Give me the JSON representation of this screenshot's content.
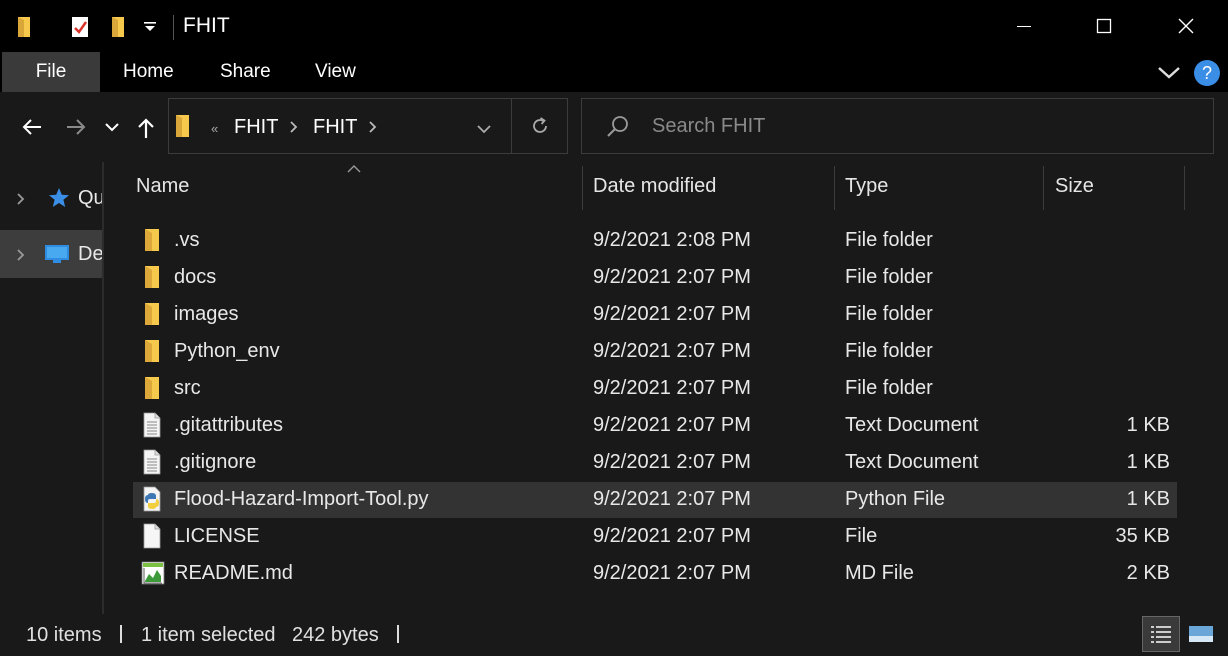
{
  "window": {
    "title": "FHIT"
  },
  "ribbon": {
    "tabs": [
      "File",
      "Home",
      "Share",
      "View"
    ]
  },
  "address": {
    "prefix": "«",
    "crumbs": [
      "FHIT",
      "FHIT"
    ]
  },
  "search": {
    "placeholder": "Search FHIT"
  },
  "nav_pane": {
    "items": [
      {
        "label": "Qu",
        "icon": "star-icon"
      },
      {
        "label": "De",
        "icon": "desktop-icon"
      }
    ]
  },
  "columns": {
    "name": "Name",
    "date": "Date modified",
    "type": "Type",
    "size": "Size"
  },
  "files": [
    {
      "name": ".vs",
      "date": "9/2/2021 2:08 PM",
      "type": "File folder",
      "size": "",
      "icon": "folder-icon"
    },
    {
      "name": "docs",
      "date": "9/2/2021 2:07 PM",
      "type": "File folder",
      "size": "",
      "icon": "folder-icon"
    },
    {
      "name": "images",
      "date": "9/2/2021 2:07 PM",
      "type": "File folder",
      "size": "",
      "icon": "folder-icon"
    },
    {
      "name": "Python_env",
      "date": "9/2/2021 2:07 PM",
      "type": "File folder",
      "size": "",
      "icon": "folder-icon"
    },
    {
      "name": "src",
      "date": "9/2/2021 2:07 PM",
      "type": "File folder",
      "size": "",
      "icon": "folder-icon"
    },
    {
      "name": ".gitattributes",
      "date": "9/2/2021 2:07 PM",
      "type": "Text Document",
      "size": "1 KB",
      "icon": "text-file-icon"
    },
    {
      "name": ".gitignore",
      "date": "9/2/2021 2:07 PM",
      "type": "Text Document",
      "size": "1 KB",
      "icon": "text-file-icon"
    },
    {
      "name": "Flood-Hazard-Import-Tool.py",
      "date": "9/2/2021 2:07 PM",
      "type": "Python File",
      "size": "1 KB",
      "icon": "python-file-icon",
      "selected": true
    },
    {
      "name": "LICENSE",
      "date": "9/2/2021 2:07 PM",
      "type": "File",
      "size": "35 KB",
      "icon": "blank-file-icon"
    },
    {
      "name": "README.md",
      "date": "9/2/2021 2:07 PM",
      "type": "MD File",
      "size": "2 KB",
      "icon": "md-file-icon"
    }
  ],
  "status": {
    "count": "10 items",
    "selected": "1 item selected",
    "bytes": "242 bytes"
  },
  "colors": {
    "background": "#191919",
    "titlebar": "#000000",
    "selected_row": "#333333",
    "folder": "#f6c94c",
    "accent": "#3a8ee6"
  }
}
